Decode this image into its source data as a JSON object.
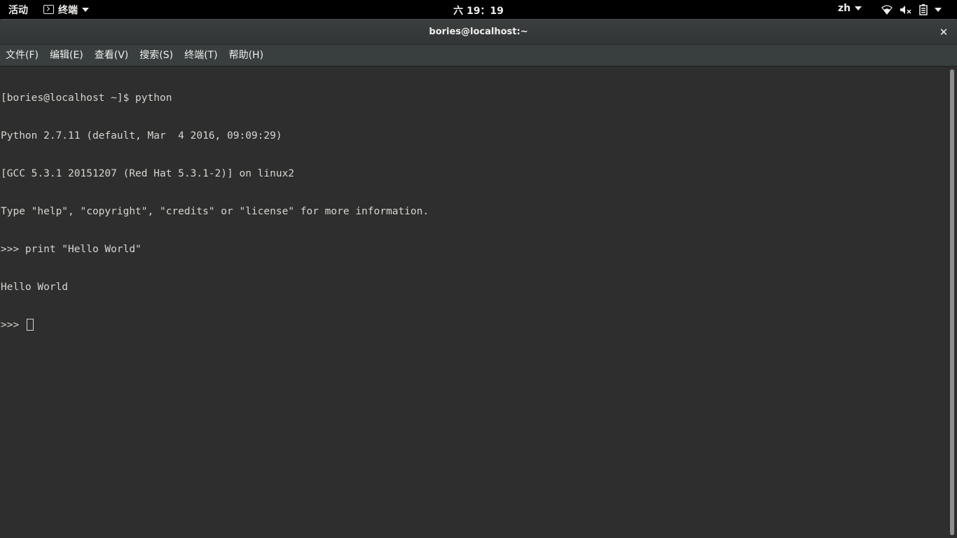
{
  "topbar": {
    "activities": "活动",
    "app_name": "终端",
    "clock": "六 19：19",
    "lang": "zh",
    "icons": [
      "terminal-icon",
      "wifi-icon",
      "volume-muted-icon",
      "battery-icon",
      "chevron-down-icon"
    ]
  },
  "window": {
    "title": "bories@localhost:~",
    "close_glyph": "✕"
  },
  "menu": {
    "file": "文件(F)",
    "edit": "编辑(E)",
    "view": "查看(V)",
    "search": "搜索(S)",
    "terminal": "终端(T)",
    "help": "帮助(H)"
  },
  "terminal": {
    "lines": [
      "[bories@localhost ~]$ python",
      "Python 2.7.11 (default, Mar  4 2016, 09:09:29)",
      "[GCC 5.3.1 20151207 (Red Hat 5.3.1-2)] on linux2",
      "Type \"help\", \"copyright\", \"credits\" or \"license\" for more information.",
      ">>> print \"Hello World\"",
      "Hello World"
    ],
    "prompt": ">>> "
  },
  "colors": {
    "terminal_bg": "#2e2e2e",
    "terminal_fg": "#d3d7cf",
    "topbar_bg": "#000000"
  }
}
